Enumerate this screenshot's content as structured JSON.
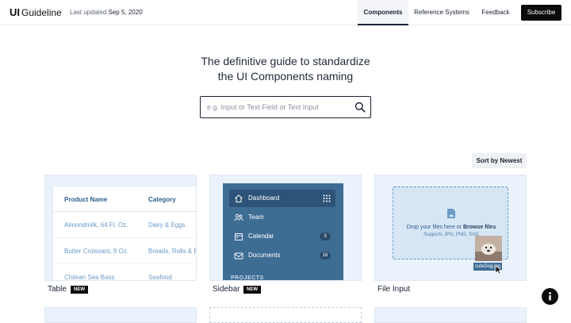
{
  "header": {
    "logo_ui": "UI",
    "logo_text": "Guideline",
    "updated_prefix": "Last updated",
    "updated_date": "Sep 5, 2020",
    "nav": [
      "Components",
      "Reference Systems",
      "Feedback"
    ],
    "subscribe_label": "Subscribe"
  },
  "hero": {
    "title_line1": "The definitive guide to standardize",
    "title_line2": "the UI Components naming",
    "search_placeholder": "e.g. Input or Text Field or Text Input"
  },
  "sort_label": "Sort by Newest",
  "cards": {
    "table": {
      "label": "Table",
      "badge": "NEW",
      "columns": [
        "Product Name",
        "Category"
      ],
      "rows": [
        [
          "Almondmilk, 64 Fl. Oz.",
          "Dairy & Eggs"
        ],
        [
          "Butter Croissant, 9 Oz.",
          "Breads, Rolls & B"
        ],
        [
          "Chilean Sea Bass",
          "Seafood"
        ]
      ]
    },
    "sidebar": {
      "label": "Sidebar",
      "badge": "NEW",
      "items": [
        {
          "label": "Dashboard"
        },
        {
          "label": "Team"
        },
        {
          "label": "Calendar",
          "count": "3"
        },
        {
          "label": "Documents",
          "count": "16"
        }
      ],
      "section": "PROJECTS"
    },
    "file_input": {
      "label": "File Input",
      "drop_text": "Drop your files here or",
      "browse_text": "Browse files",
      "support_text": "Supports JPG, PNG, SVG",
      "file_name": "cuteDog.jpg"
    }
  },
  "colors": {
    "accent": "#0b0b0b",
    "card_bg": "#eaf2fb",
    "sidebar_bg": "#3e6d94",
    "table_text": "#6a9ac6"
  }
}
